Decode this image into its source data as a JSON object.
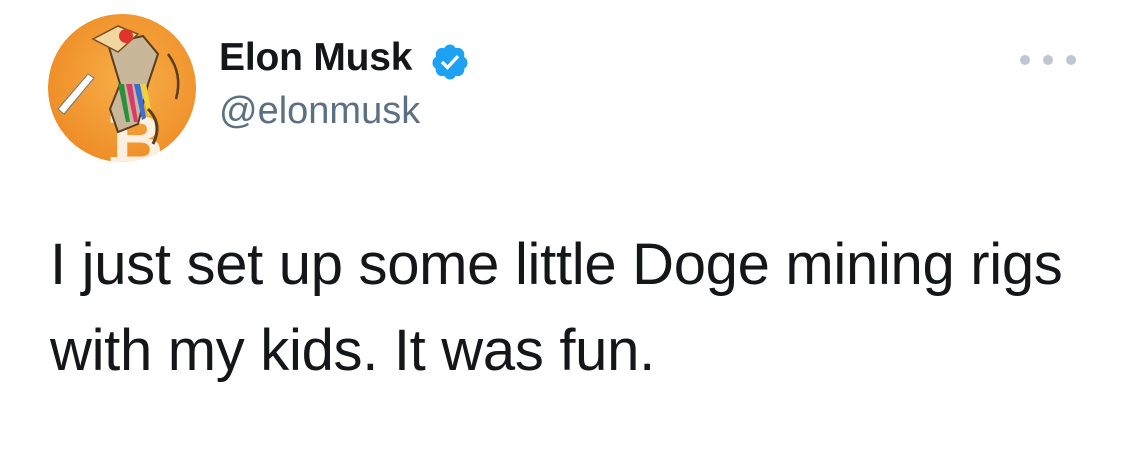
{
  "tweet": {
    "author": {
      "name": "Elon Musk",
      "handle": "@elonmusk",
      "verified": true,
      "avatar_icon": "doge-avatar-icon"
    },
    "text": "I just set up some little Doge mining rigs with my kids. It was fun.",
    "more_icon": "more-options-icon"
  },
  "colors": {
    "name": "#14171a",
    "handle": "#5b7083",
    "verified_badge": "#1da1f2",
    "avatar_bg": "#f4a23a",
    "more_dots": "#bcc7d1"
  }
}
